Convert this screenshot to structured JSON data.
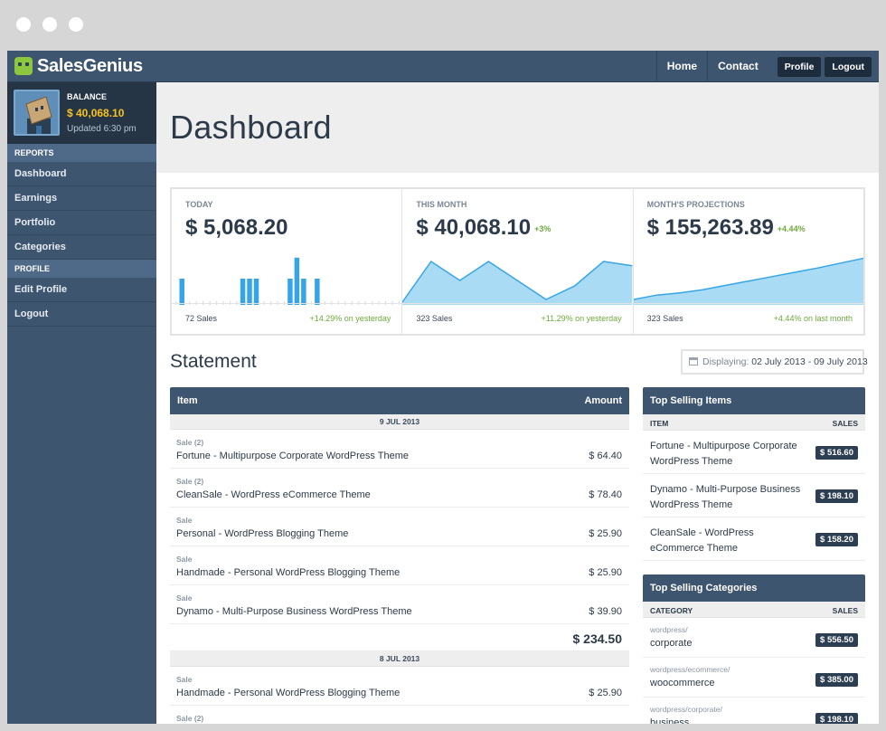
{
  "app": {
    "name_bold": "Sales",
    "name_rest": "Genius"
  },
  "nav": {
    "home": "Home",
    "contact": "Contact",
    "profile": "Profile",
    "logout": "Logout"
  },
  "sidebar": {
    "balance_label": "BALANCE",
    "balance_value": "$ 40,068.10",
    "balance_updated": "Updated 6:30 pm",
    "sections": [
      {
        "header": "REPORTS",
        "items": [
          "Dashboard",
          "Earnings",
          "Portfolio",
          "Categories"
        ]
      },
      {
        "header": "PROFILE",
        "items": [
          "Edit Profile",
          "Logout"
        ]
      }
    ]
  },
  "page_title": "Dashboard",
  "stats": [
    {
      "label": "TODAY",
      "value": "$ 5,068.20",
      "delta": "",
      "sales": "72 Sales",
      "trend": "+14.29% on yesterday"
    },
    {
      "label": "THIS MONTH",
      "value": "$ 40,068.10",
      "delta": "+3%",
      "sales": "323 Sales",
      "trend": "+11.29% on yesterday"
    },
    {
      "label": "MONTH'S PROJECTIONS",
      "value": "$ 155,263.89",
      "delta": "+4.44%",
      "sales": "323 Sales",
      "trend": "+4.44% on last month"
    }
  ],
  "charts": {
    "today_bars": [
      0,
      1,
      0,
      0,
      0,
      0,
      0,
      0,
      0,
      0,
      1,
      1,
      1,
      0,
      0,
      0,
      0,
      1,
      1.8,
      1,
      0,
      1,
      0,
      0,
      0,
      0,
      0,
      0,
      0,
      0,
      0,
      0,
      0,
      0
    ],
    "month_line": [
      0.05,
      0.8,
      0.45,
      0.8,
      0.45,
      0.1,
      0.35,
      0.8,
      0.72
    ],
    "projection_line": [
      0.1,
      0.18,
      0.22,
      0.28,
      0.36,
      0.44,
      0.52,
      0.6,
      0.68,
      0.77,
      0.86
    ]
  },
  "statement": {
    "title": "Statement",
    "date_label": "Displaying:",
    "date_range": "02 July 2013 - 09 July 2013",
    "col_item": "Item",
    "col_amount": "Amount",
    "days": [
      {
        "date": "9 JUL 2013",
        "total": "$ 234.50",
        "rows": [
          {
            "type": "Sale (2)",
            "name": "Fortune - Multipurpose Corporate WordPress Theme",
            "amount": "$ 64.40"
          },
          {
            "type": "Sale (2)",
            "name": "CleanSale - WordPress eCommerce Theme",
            "amount": "$ 78.40"
          },
          {
            "type": "Sale",
            "name": "Personal - WordPress Blogging Theme",
            "amount": "$ 25.90"
          },
          {
            "type": "Sale",
            "name": "Handmade - Personal WordPress Blogging Theme",
            "amount": "$ 25.90"
          },
          {
            "type": "Sale",
            "name": "Dynamo - Multi-Purpose Business WordPress Theme",
            "amount": "$ 39.90"
          }
        ]
      },
      {
        "date": "8 JUL 2013",
        "total": "",
        "rows": [
          {
            "type": "Sale",
            "name": "Handmade - Personal WordPress Blogging Theme",
            "amount": "$ 25.90"
          },
          {
            "type": "Sale (2)",
            "name": "",
            "amount": ""
          }
        ]
      }
    ]
  },
  "top_items": {
    "title": "Top Selling Items",
    "col_item": "ITEM",
    "col_sales": "SALES",
    "rows": [
      {
        "name": "Fortune - Multipurpose Corporate WordPress Theme",
        "sales": "$ 516.60"
      },
      {
        "name": "Dynamo - Multi-Purpose Business WordPress Theme",
        "sales": "$ 198.10"
      },
      {
        "name": "CleanSale - WordPress eCommerce Theme",
        "sales": "$ 158.20"
      }
    ]
  },
  "top_categories": {
    "title": "Top Selling Categories",
    "col_item": "CATEGORY",
    "col_sales": "SALES",
    "rows": [
      {
        "path": "wordpress/",
        "name": "corporate",
        "sales": "$ 556.50"
      },
      {
        "path": "wordpress/ecommerce/",
        "name": "woocommerce",
        "sales": "$ 385.00"
      },
      {
        "path": "wordpress/corporate/",
        "name": "business",
        "sales": "$ 198.10"
      }
    ]
  }
}
